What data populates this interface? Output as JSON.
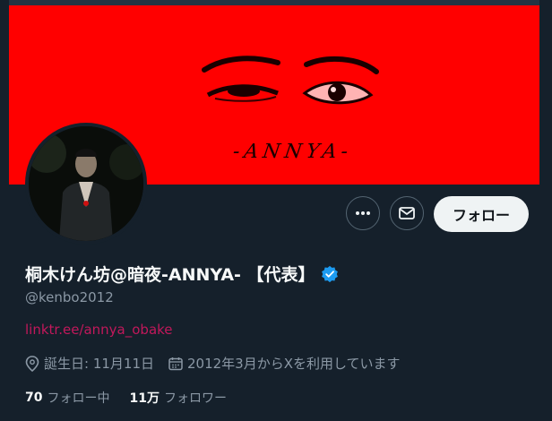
{
  "banner": {
    "text": "-ANNYA-",
    "color": "#ff0000"
  },
  "profile": {
    "display_name": "桐木けん坊@暗夜-ANNYA- 【代表】",
    "handle": "@kenbo2012",
    "link": "linktr.ee/annya_obake",
    "birthday": "誕生日: 11月11日",
    "joined": "2012年3月からXを利用しています",
    "verified": true
  },
  "actions": {
    "follow_label": "フォロー",
    "more_icon": "more-icon",
    "mail_icon": "mail-icon"
  },
  "stats": {
    "following_count": "70",
    "following_label": "フォロー中",
    "followers_count": "11万",
    "followers_label": "フォロワー"
  },
  "colors": {
    "background": "#15202b",
    "link": "#c2185b",
    "verified": "#1d9bf0",
    "secondary_text": "#8b98a5"
  }
}
